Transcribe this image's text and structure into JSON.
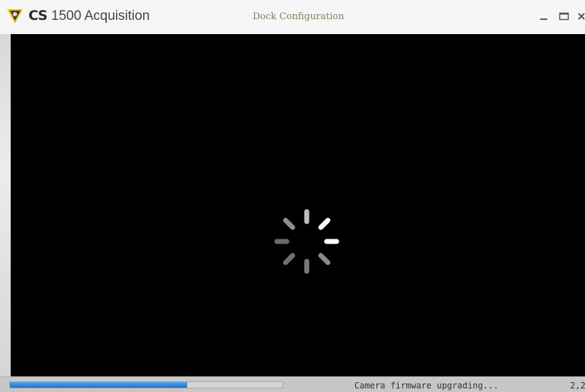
{
  "window": {
    "brand": "CS",
    "app_title": "1500 Acquisition",
    "subtitle": "Dock Configuration",
    "controls": [
      "minimize-icon",
      "maximize-icon",
      "close-icon"
    ]
  },
  "viewport": {
    "background": "#000000",
    "state": "loading",
    "spinner_icon": "loading-spinner-icon"
  },
  "status": {
    "progress_fraction": 0.65,
    "progress_color": "#2a7fe0",
    "message": "Camera firmware upgrading...",
    "value": "2,2"
  },
  "colors": {
    "logo_yellow": "#f2c200",
    "logo_dark": "#3a3a3a"
  }
}
